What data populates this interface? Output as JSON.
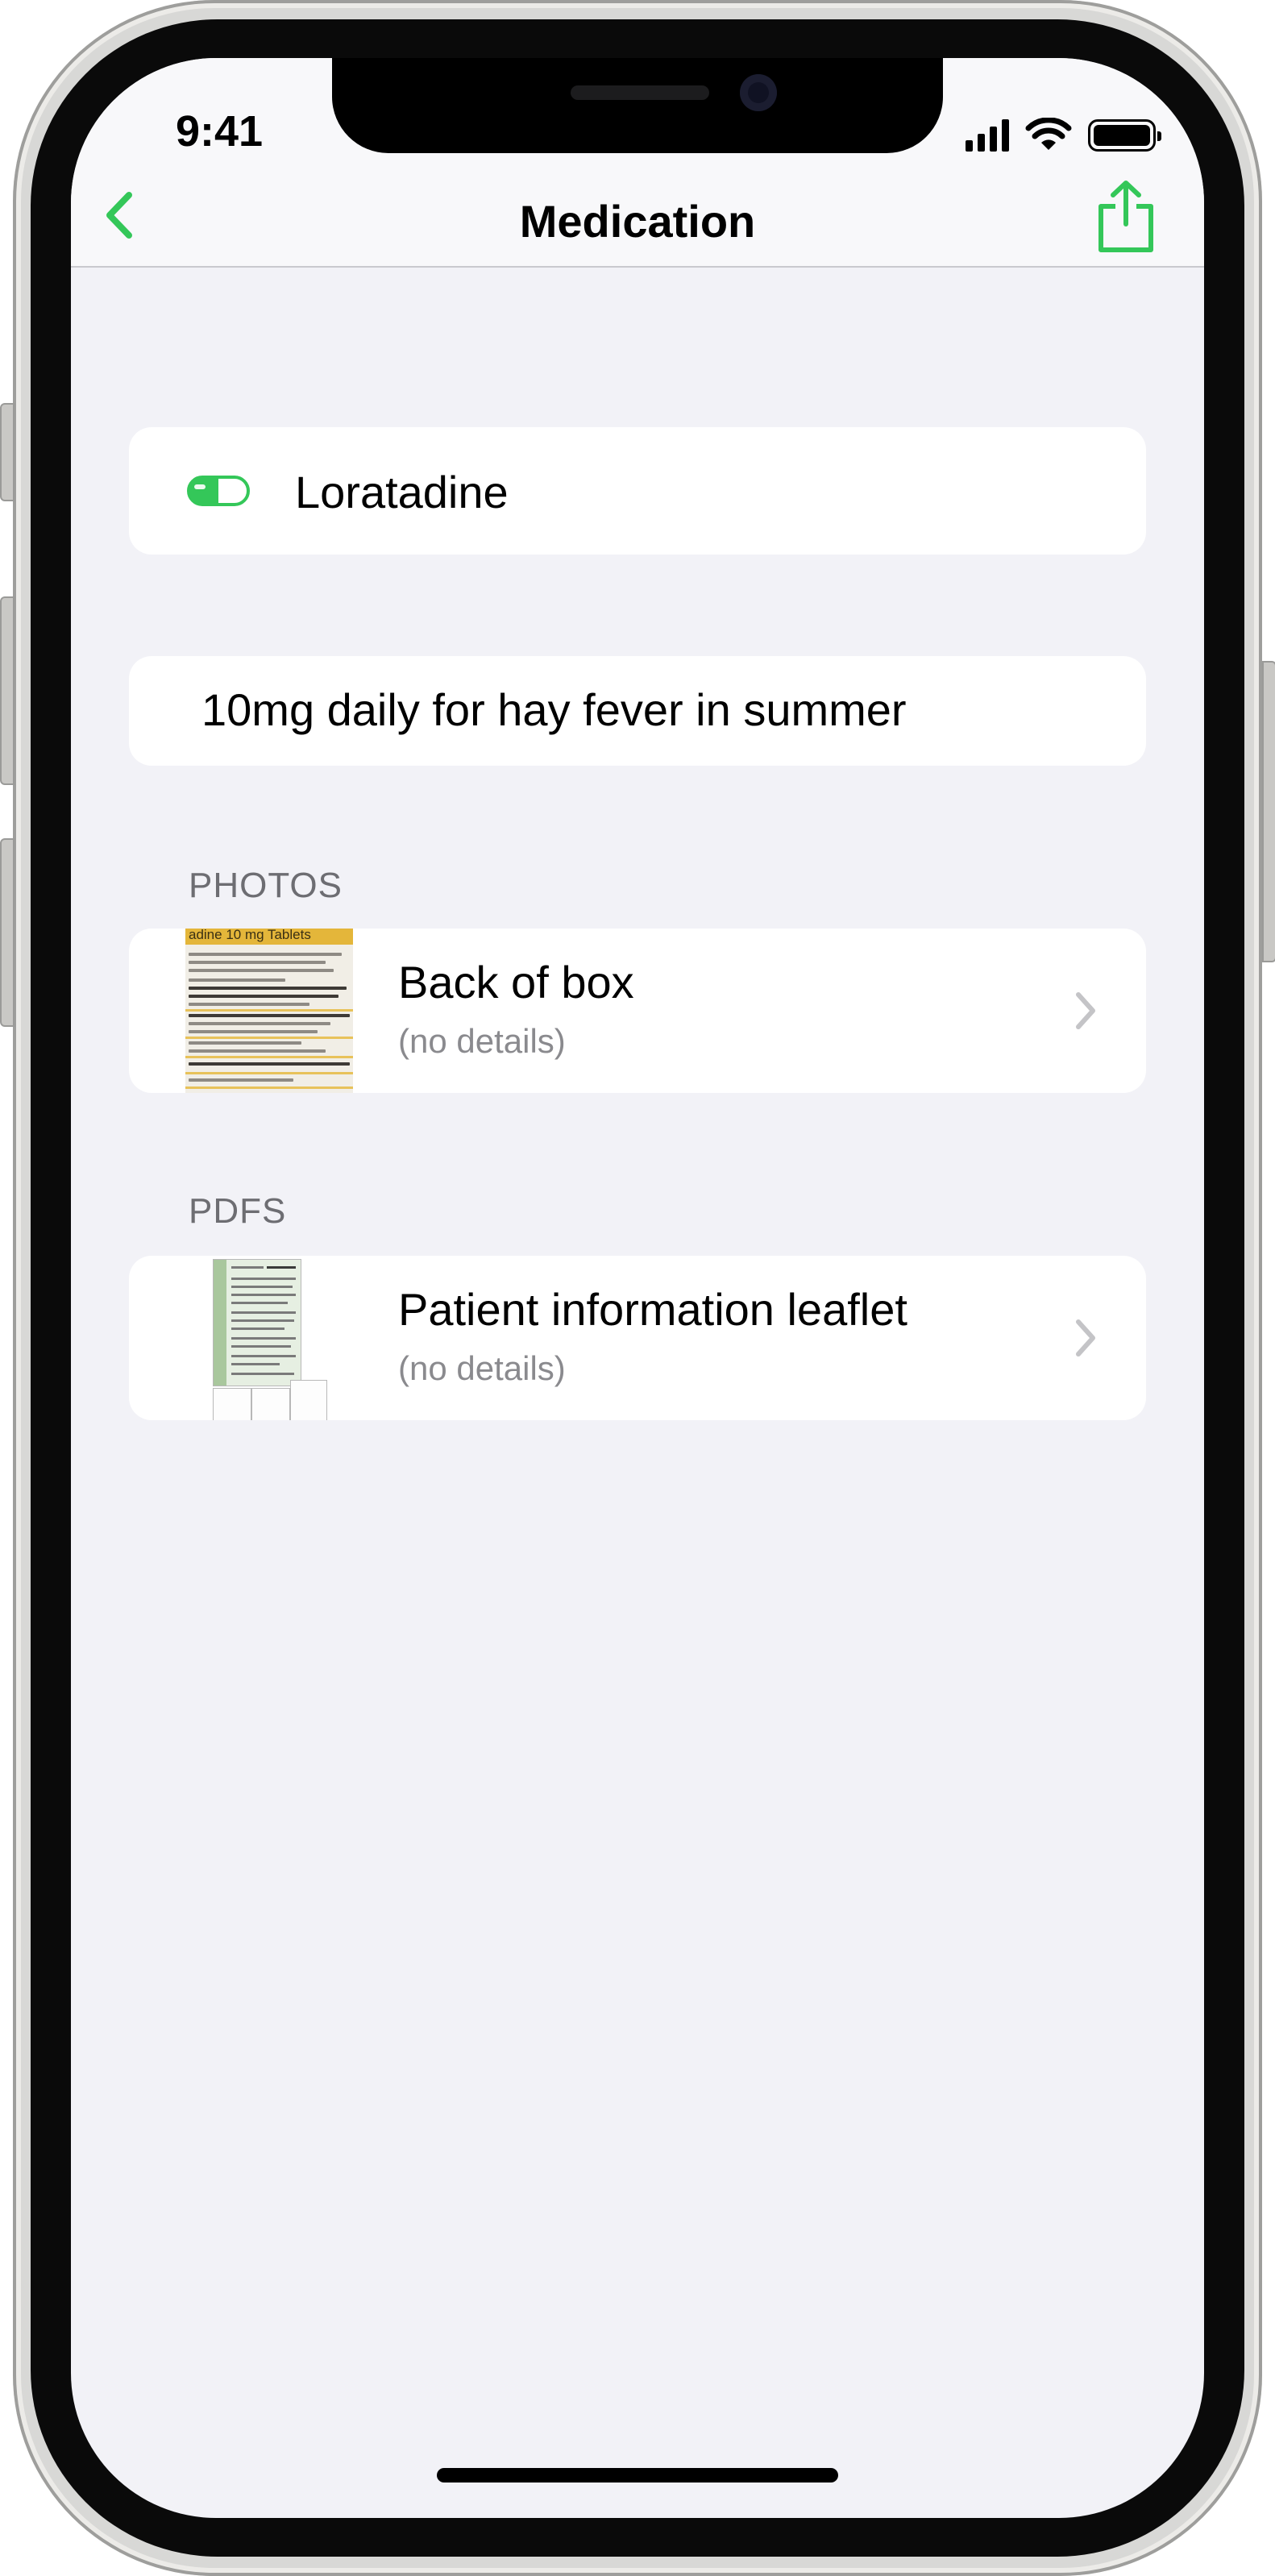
{
  "status_bar": {
    "time": "9:41"
  },
  "navigation": {
    "title": "Medication",
    "back_icon": "chevron-left-icon",
    "share_icon": "share-icon"
  },
  "medication": {
    "name": "Loratadine",
    "status_icon": "pill-toggle-icon",
    "accent_color": "#34c759"
  },
  "notes": {
    "text": "10mg daily for hay fever in summer"
  },
  "photos": {
    "header": "PHOTOS",
    "items": [
      {
        "title": "Back of box",
        "subtitle": "(no details)",
        "thumbnail_text": "adine 10 mg Tablets"
      }
    ]
  },
  "pdfs": {
    "header": "PDFS",
    "items": [
      {
        "title": "Patient information leaflet",
        "subtitle": "(no details)"
      }
    ]
  },
  "colors": {
    "accent": "#34c759",
    "background": "#f2f2f7",
    "card": "#ffffff",
    "secondary_text": "#8a8a8e",
    "section_header": "#6d6d72"
  }
}
